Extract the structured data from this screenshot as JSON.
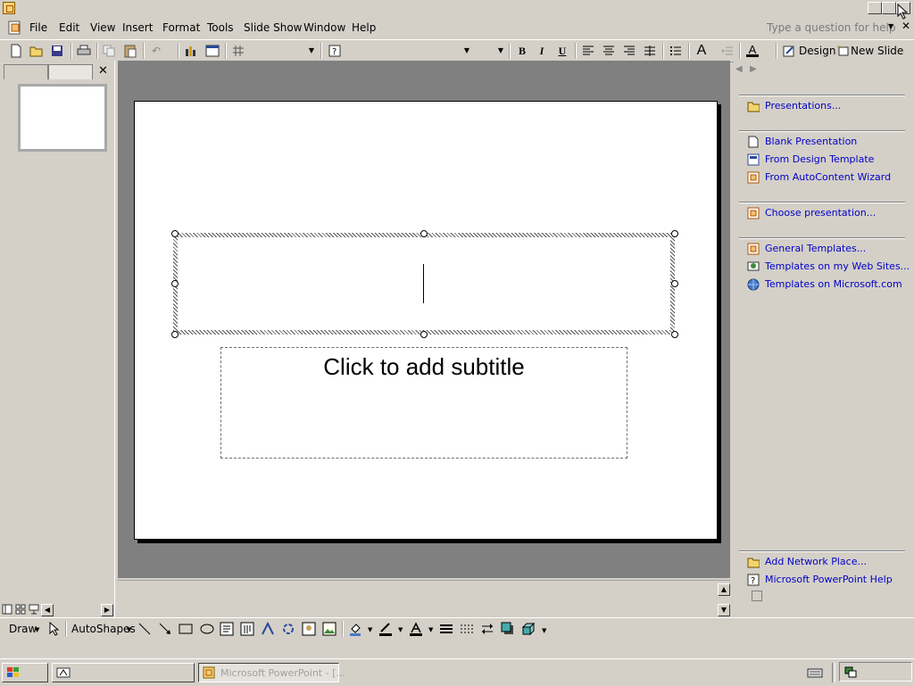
{
  "app": {
    "name": "PowerPoint"
  },
  "menu": {
    "items": [
      "File",
      "Edit",
      "View",
      "Insert",
      "Format",
      "Tools",
      "Slide Show",
      "Window",
      "Help"
    ],
    "help_placeholder": "Type a question for help"
  },
  "toolbar": {
    "design_label": "Design",
    "new_slide_label": "New Slide",
    "bold": "B",
    "italic": "I",
    "underline": "U",
    "grow_font": "A",
    "font_color": "A"
  },
  "slide": {
    "subtitle_placeholder": "Click to add subtitle"
  },
  "task_pane": {
    "open_links": [
      "Presentations..."
    ],
    "new_links": [
      "Blank Presentation",
      "From Design Template",
      "From AutoContent Wizard"
    ],
    "existing_links": [
      "Choose presentation..."
    ],
    "template_links": [
      "General Templates...",
      "Templates on my Web Sites...",
      "Templates on Microsoft.com"
    ],
    "bottom_links": [
      "Add Network Place...",
      "Microsoft PowerPoint Help"
    ]
  },
  "drawing": {
    "draw_label": "Draw",
    "autoshapes_label": "AutoShapes"
  },
  "taskbar": {
    "app_button_label": "Microsoft PowerPoint - [..."
  },
  "colors": {
    "chrome": "#d4d0c8",
    "slide_bg": "#808080",
    "link": "#0000c8"
  }
}
